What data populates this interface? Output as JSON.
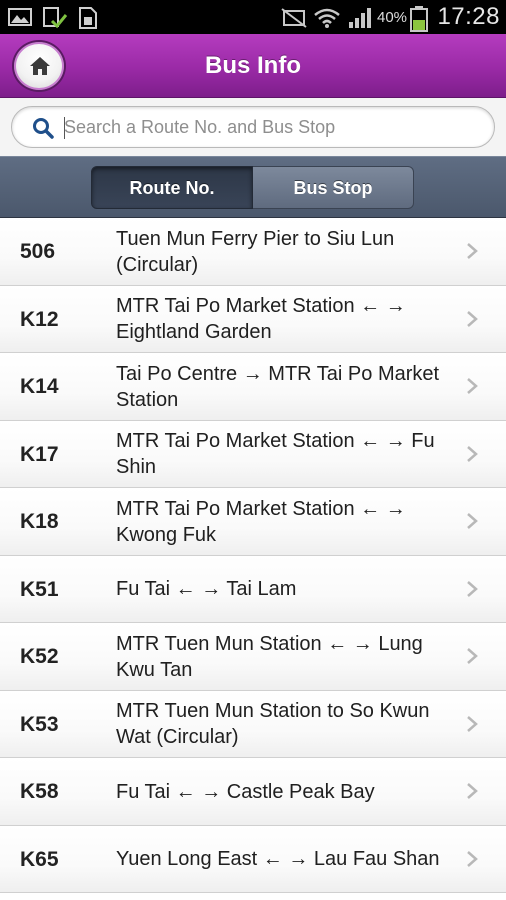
{
  "status_bar": {
    "battery_percent": "40%",
    "time": "17:28"
  },
  "header": {
    "title": "Bus Info"
  },
  "search": {
    "placeholder": "Search a Route No. and Bus Stop",
    "value": ""
  },
  "segments": {
    "route_label": "Route No.",
    "stop_label": "Bus Stop",
    "selected": "Route No."
  },
  "routes": [
    {
      "number": "506",
      "description": "Tuen Mun Ferry Pier to Siu Lun (Circular)"
    },
    {
      "number": "K12",
      "description": "MTR Tai Po Market Station ← → Eightland Garden"
    },
    {
      "number": "K14",
      "description": "Tai Po Centre → MTR Tai Po Market Station"
    },
    {
      "number": "K17",
      "description": "MTR Tai Po Market Station ← → Fu Shin"
    },
    {
      "number": "K18",
      "description": "MTR Tai Po Market Station ← → Kwong Fuk"
    },
    {
      "number": "K51",
      "description": "Fu Tai ← → Tai Lam"
    },
    {
      "number": "K52",
      "description": "MTR Tuen Mun Station ← → Lung Kwu Tan"
    },
    {
      "number": "K53",
      "description": "MTR Tuen Mun Station to So Kwun Wat (Circular)"
    },
    {
      "number": "K58",
      "description": "Fu Tai ← → Castle Peak Bay"
    },
    {
      "number": "K65",
      "description": "Yuen Long East ← → Lau Fau Shan"
    }
  ],
  "colors": {
    "header_accent": "#9a2aa6",
    "segment_bar": "#56637a"
  }
}
